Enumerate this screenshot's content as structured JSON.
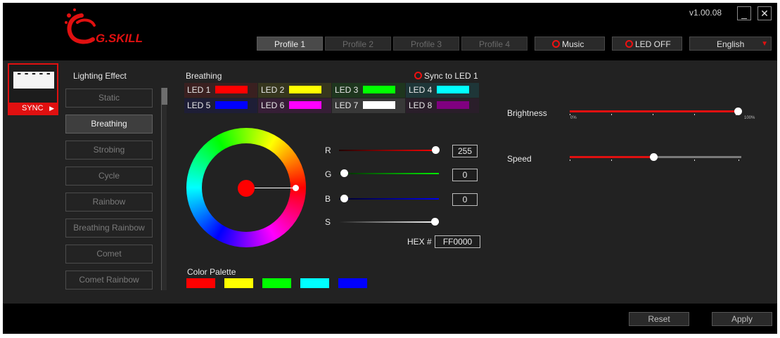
{
  "app": {
    "brand": "G.SKILL",
    "version": "v1.00.08"
  },
  "window_controls": {
    "minimize": "_",
    "close": "✕"
  },
  "profiles": [
    {
      "label": "Profile 1",
      "active": true
    },
    {
      "label": "Profile 2",
      "active": false
    },
    {
      "label": "Profile 3",
      "active": false
    },
    {
      "label": "Profile 4",
      "active": false
    }
  ],
  "toolbar": {
    "music_label": "Music",
    "led_off_label": "LED OFF",
    "language_value": "English"
  },
  "sidebar": {
    "sync_label": "SYNC"
  },
  "lighting": {
    "heading": "Lighting Effect",
    "effects": [
      "Static",
      "Breathing",
      "Strobing",
      "Cycle",
      "Rainbow",
      "Breathing Rainbow",
      "Comet",
      "Comet Rainbow"
    ],
    "selected": "Breathing"
  },
  "panel": {
    "title": "Breathing",
    "sync_to_led": "Sync to LED 1"
  },
  "leds": [
    {
      "label": "LED 1",
      "color": "#ff0000"
    },
    {
      "label": "LED 2",
      "color": "#ffff00"
    },
    {
      "label": "LED 3",
      "color": "#00ff00"
    },
    {
      "label": "LED 4",
      "color": "#00ffff"
    },
    {
      "label": "LED 5",
      "color": "#0000ff"
    },
    {
      "label": "LED 6",
      "color": "#ff00ff"
    },
    {
      "label": "LED 7",
      "color": "#ffffff"
    },
    {
      "label": "LED 8",
      "color": "#800080"
    }
  ],
  "color": {
    "r_label": "R",
    "g_label": "G",
    "b_label": "B",
    "s_label": "S",
    "r": "255",
    "g": "0",
    "b": "0",
    "hex_label": "HEX #",
    "hex": "FF0000"
  },
  "palette": {
    "heading": "Color Palette",
    "colors": [
      "#ff0000",
      "#ffff00",
      "#00ff00",
      "#00ffff",
      "#0000ff"
    ]
  },
  "brightness": {
    "label": "Brightness",
    "min_label": "0%",
    "max_label": "100%",
    "level": 1.0
  },
  "speed": {
    "label": "Speed",
    "level": 0.5
  },
  "footer": {
    "reset_label": "Reset",
    "apply_label": "Apply"
  },
  "colors": {
    "accent": "#e01010",
    "background": "#222222",
    "topbar": "#000000"
  }
}
